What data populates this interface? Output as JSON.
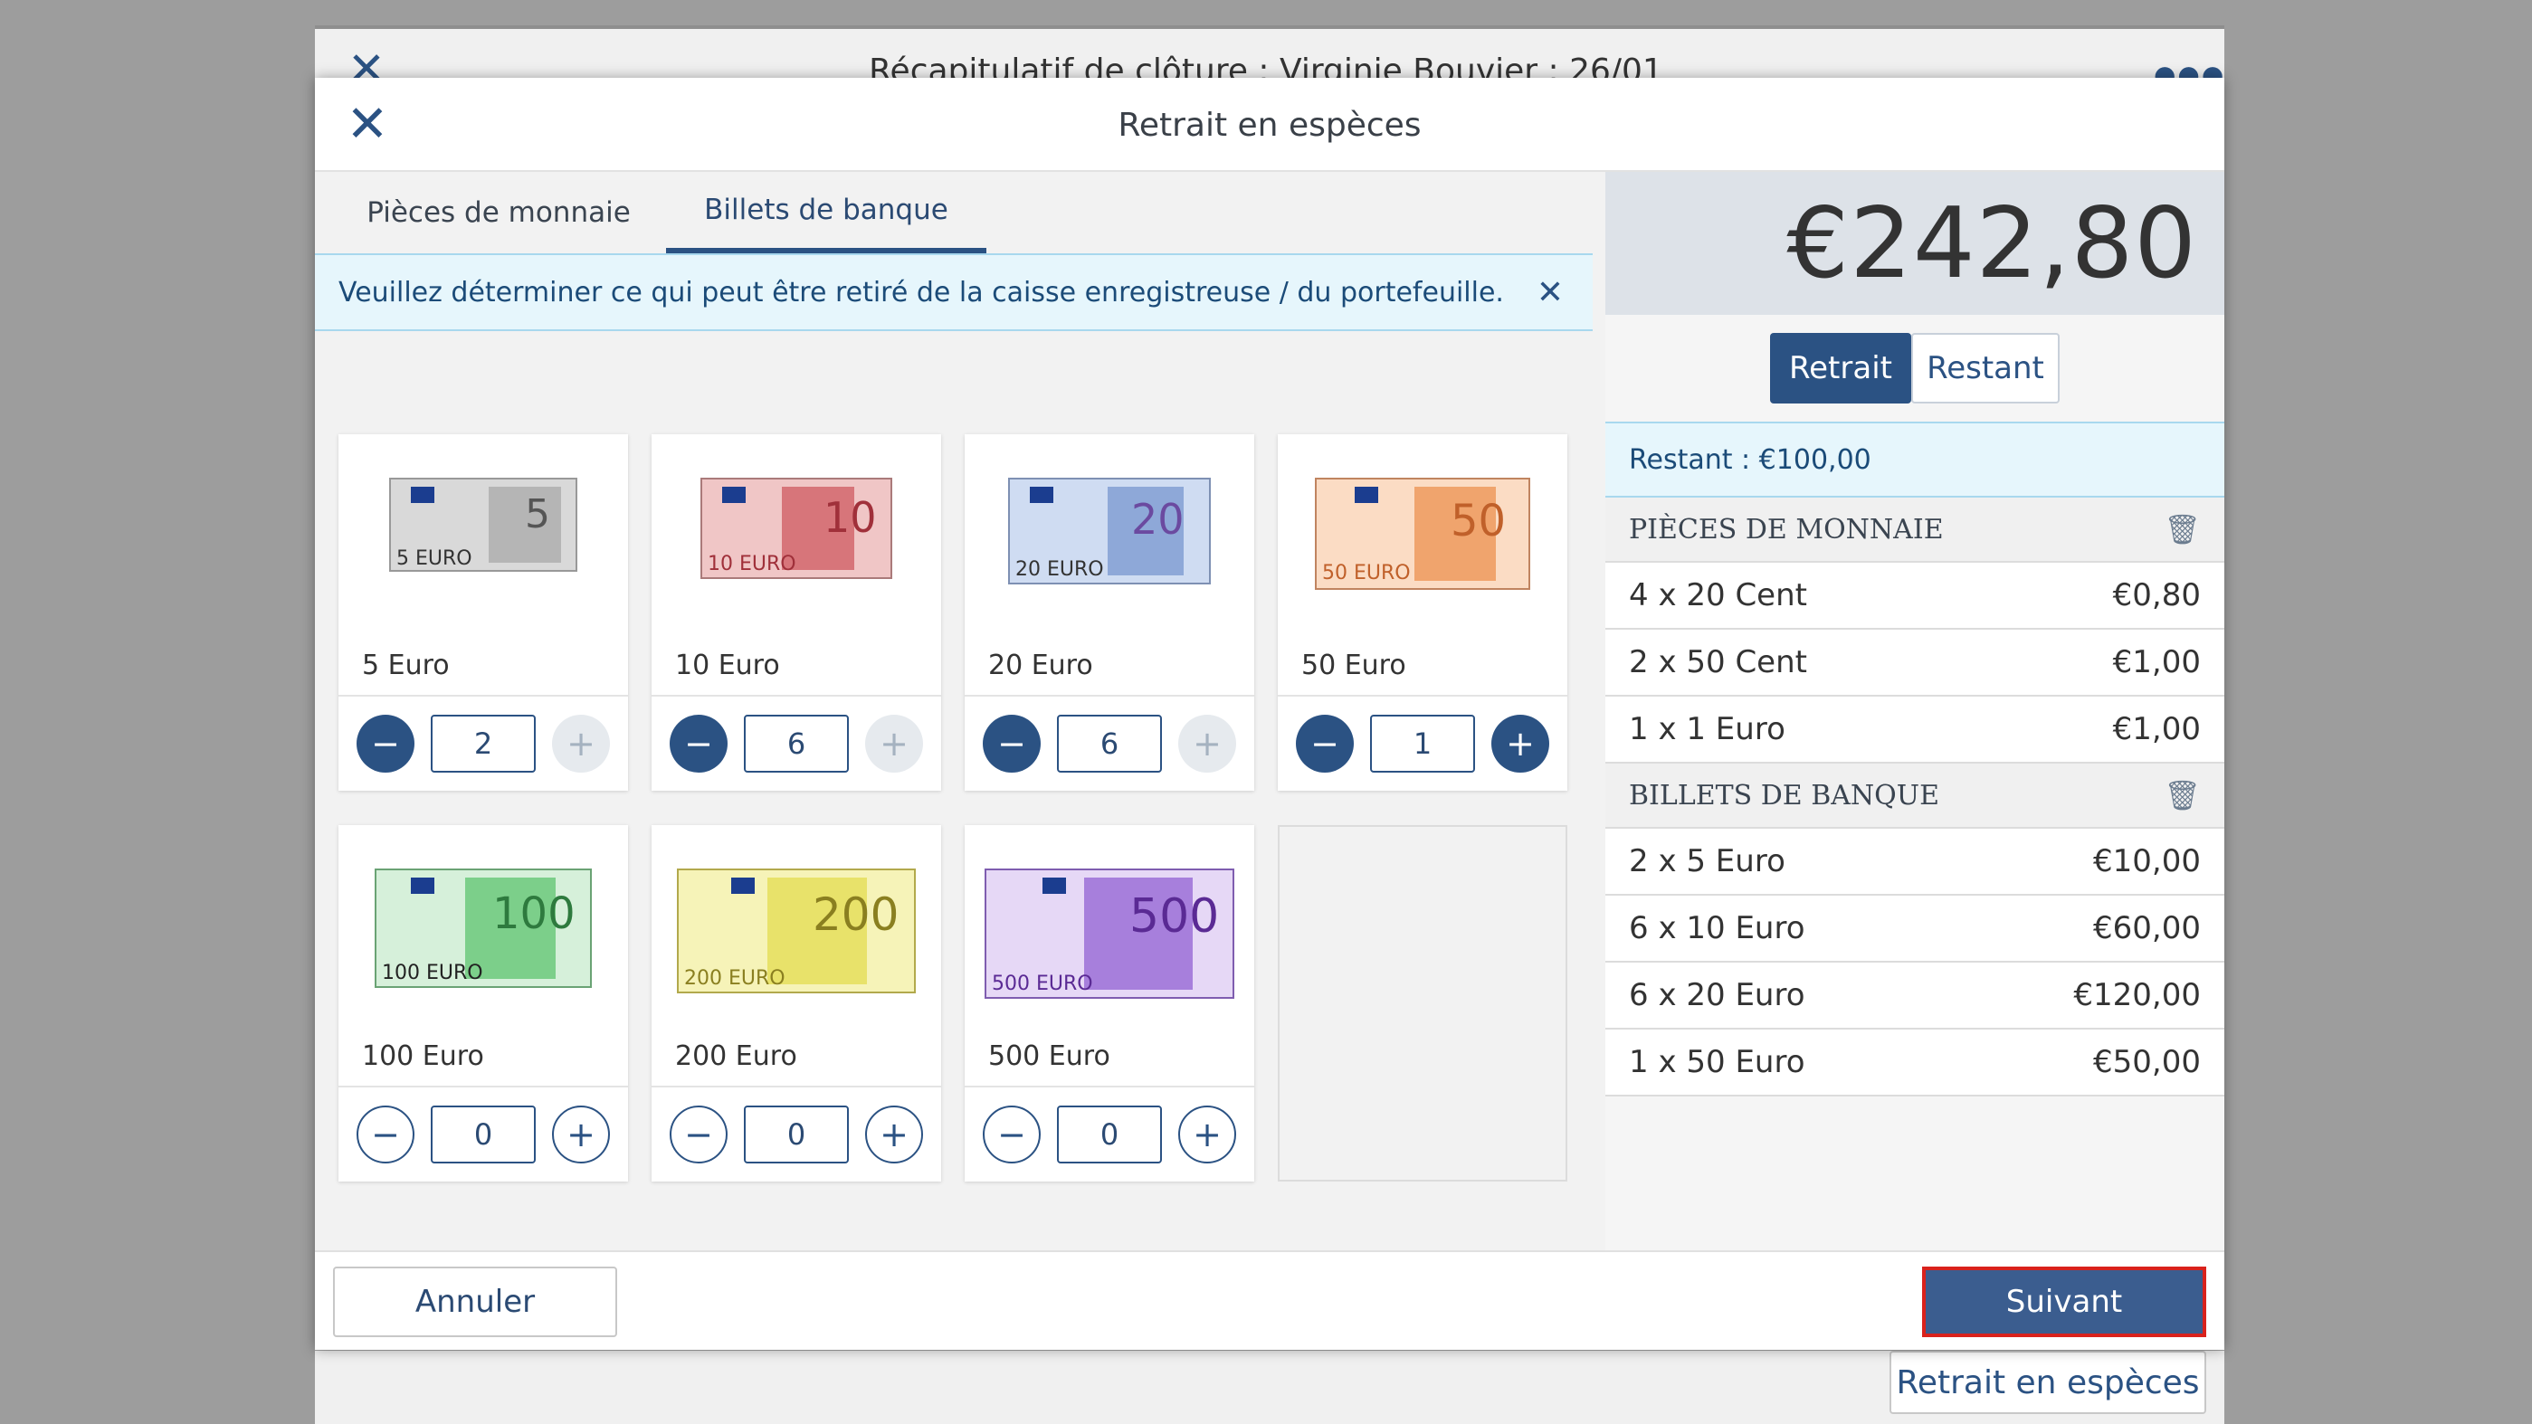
{
  "background": {
    "title": "Récapitulatif de clôture : Virginie Bouvier : 26/01",
    "footer_button": "Retrait en espèces"
  },
  "modal": {
    "title": "Retrait en espèces",
    "tabs": [
      {
        "label": "Pièces de monnaie",
        "active": false
      },
      {
        "label": "Billets de banque",
        "active": true
      }
    ],
    "info": "Veuillez déterminer ce qui peut être retiré de la caisse enregistreuse / du portefeuille.",
    "notes": [
      {
        "label": "5 Euro",
        "qty": "2",
        "value": "5",
        "color": "#c7c7c7"
      },
      {
        "label": "10 Euro",
        "qty": "6",
        "value": "10",
        "color": "#e08a8a"
      },
      {
        "label": "20 Euro",
        "qty": "6",
        "value": "20",
        "color": "#8fb0de"
      },
      {
        "label": "50 Euro",
        "qty": "1",
        "value": "50",
        "color": "#f2ad80"
      },
      {
        "label": "100 Euro",
        "qty": "0",
        "value": "100",
        "color": "#7ccf8a"
      },
      {
        "label": "200 Euro",
        "qty": "0",
        "value": "200",
        "color": "#e8e26a"
      },
      {
        "label": "500 Euro",
        "qty": "0",
        "value": "500",
        "color": "#a77fdc"
      }
    ],
    "total": "€242,80",
    "segment": {
      "withdraw": "Retrait",
      "remaining": "Restant"
    },
    "remaining_text": "Restant : €100,00",
    "coins_header": "PIÈCES DE MONNAIE",
    "coins": [
      {
        "label": "4 x 20 Cent",
        "amount": "€0,80"
      },
      {
        "label": "2 x 50 Cent",
        "amount": "€1,00"
      },
      {
        "label": "1 x 1 Euro",
        "amount": "€1,00"
      }
    ],
    "notes_header": "BILLETS DE BANQUE",
    "note_rows": [
      {
        "label": "2 x 5 Euro",
        "amount": "€10,00"
      },
      {
        "label": "6 x 10 Euro",
        "amount": "€60,00"
      },
      {
        "label": "6 x 20 Euro",
        "amount": "€120,00"
      },
      {
        "label": "1 x 50 Euro",
        "amount": "€50,00"
      }
    ],
    "cancel": "Annuler",
    "next": "Suivant"
  }
}
